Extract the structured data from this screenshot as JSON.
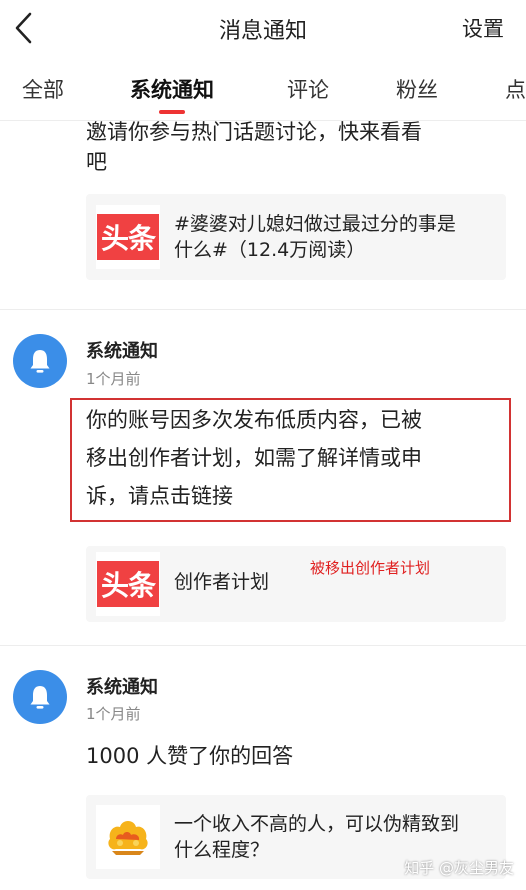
{
  "header": {
    "title": "消息通知",
    "settings_label": "设置"
  },
  "tabs": [
    {
      "label": "全部"
    },
    {
      "label": "系统通知"
    },
    {
      "label": "评论"
    },
    {
      "label": "粉丝"
    },
    {
      "label": "点"
    }
  ],
  "notifications": [
    {
      "text_line_1": "邀请你参与热门话题讨论，快来看看",
      "text_line_2": "吧",
      "card": {
        "logo_text": "头条",
        "line_1": "#婆婆对儿媳妇做过最过分的事是",
        "line_2": "什么#（12.4万阅读）"
      }
    },
    {
      "sender": "系统通知",
      "time": "1个月前",
      "text_line_1": "你的账号因多次发布低质内容，已被",
      "text_line_2": "移出创作者计划，如需了解详情或申",
      "text_line_3": "诉，请点击链接",
      "card": {
        "logo_text": "头条",
        "line_1": "创作者计划"
      },
      "annotation": "被移出创作者计划"
    },
    {
      "sender": "系统通知",
      "time": "1个月前",
      "text_line_1": "1000 人赞了你的回答",
      "card": {
        "line_1": "一个收入不高的人，可以伪精致到",
        "line_2": "什么程度？"
      }
    }
  ],
  "watermark": "知乎 @灰尘男友",
  "colors": {
    "accent_red": "#ee3333",
    "avatar_blue": "#3b8ee8",
    "toutiao_red": "#f04142",
    "highlight_border": "#d23333"
  }
}
